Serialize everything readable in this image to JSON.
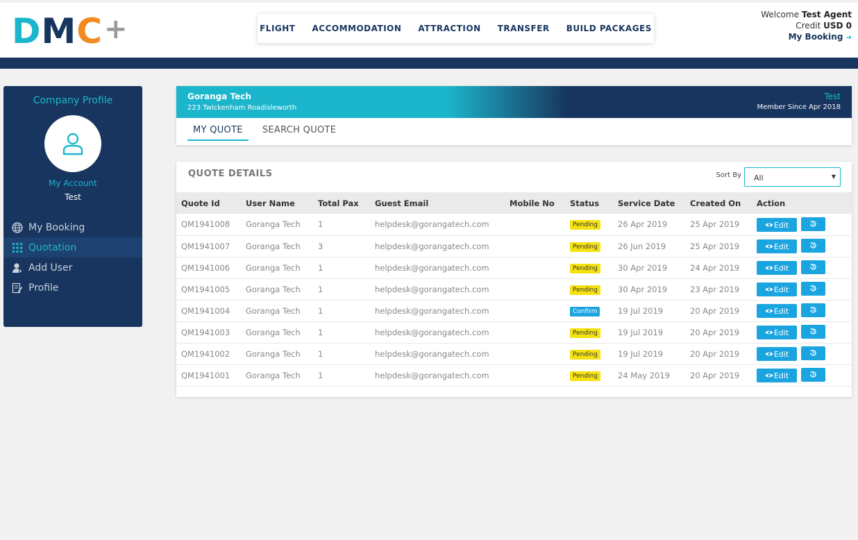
{
  "brand": {
    "d": "D",
    "m": "M",
    "c": "C",
    "plus": "+"
  },
  "nav": [
    "FLIGHT",
    "ACCOMMODATION",
    "ATTRACTION",
    "TRANSFER",
    "BUILD PACKAGES"
  ],
  "user": {
    "welcome_label": "Welcome",
    "name": "Test Agent",
    "credit_label": "Credit",
    "credit_value": "USD 0",
    "my_booking": "My Booking"
  },
  "sidebar": {
    "title": "Company Profile",
    "account_label": "My Account",
    "account_name": "Test",
    "items": [
      {
        "label": "My Booking",
        "icon": "globe-icon"
      },
      {
        "label": "Quotation",
        "icon": "grid-icon"
      },
      {
        "label": "Add User",
        "icon": "user-add-icon"
      },
      {
        "label": "Profile",
        "icon": "edit-profile-icon"
      }
    ]
  },
  "company": {
    "name": "Goranga Tech",
    "address": "223 Twickenham Roadisleworth",
    "user": "Test",
    "member_since": "Member Since Apr 2018"
  },
  "tabs": [
    "MY QUOTE",
    "SEARCH QUOTE"
  ],
  "panel": {
    "title": "QUOTE DETAILS",
    "sort_label": "Sort By",
    "sort_value": "All"
  },
  "table": {
    "headers": [
      "Quote Id",
      "User Name",
      "Total Pax",
      "Guest Email",
      "Mobile No",
      "Status",
      "Service Date",
      "Created On",
      "Action"
    ],
    "edit_label": "Edit",
    "rows": [
      {
        "id": "QM1941008",
        "user": "Goranga Tech",
        "pax": "1",
        "email": "helpdesk@gorangatech.com",
        "mobile": "",
        "status": "Pending",
        "service": "26 Apr 2019",
        "created": "25 Apr 2019"
      },
      {
        "id": "QM1941007",
        "user": "Goranga Tech",
        "pax": "3",
        "email": "helpdesk@gorangatech.com",
        "mobile": "",
        "status": "Pending",
        "service": "26 Jun 2019",
        "created": "25 Apr 2019"
      },
      {
        "id": "QM1941006",
        "user": "Goranga Tech",
        "pax": "1",
        "email": "helpdesk@gorangatech.com",
        "mobile": "",
        "status": "Pending",
        "service": "30 Apr 2019",
        "created": "24 Apr 2019"
      },
      {
        "id": "QM1941005",
        "user": "Goranga Tech",
        "pax": "1",
        "email": "helpdesk@gorangatech.com",
        "mobile": "",
        "status": "Pending",
        "service": "30 Apr 2019",
        "created": "23 Apr 2019"
      },
      {
        "id": "QM1941004",
        "user": "Goranga Tech",
        "pax": "1",
        "email": "helpdesk@gorangatech.com",
        "mobile": "",
        "status": "Confirm",
        "service": "19 Jul 2019",
        "created": "20 Apr 2019"
      },
      {
        "id": "QM1941003",
        "user": "Goranga Tech",
        "pax": "1",
        "email": "helpdesk@gorangatech.com",
        "mobile": "",
        "status": "Pending",
        "service": "19 Jul 2019",
        "created": "20 Apr 2019"
      },
      {
        "id": "QM1941002",
        "user": "Goranga Tech",
        "pax": "1",
        "email": "helpdesk@gorangatech.com",
        "mobile": "",
        "status": "Pending",
        "service": "19 Jul 2019",
        "created": "20 Apr 2019"
      },
      {
        "id": "QM1941001",
        "user": "Goranga Tech",
        "pax": "1",
        "email": "helpdesk@gorangatech.com",
        "mobile": "",
        "status": "Pending",
        "service": "24 May 2019",
        "created": "20 Apr 2019"
      }
    ]
  },
  "colors": {
    "navy": "#17355e",
    "teal": "#1cb6cc",
    "orange": "#f28c22",
    "action_blue": "#1aa4e0",
    "pending_yellow": "#f5e211"
  }
}
